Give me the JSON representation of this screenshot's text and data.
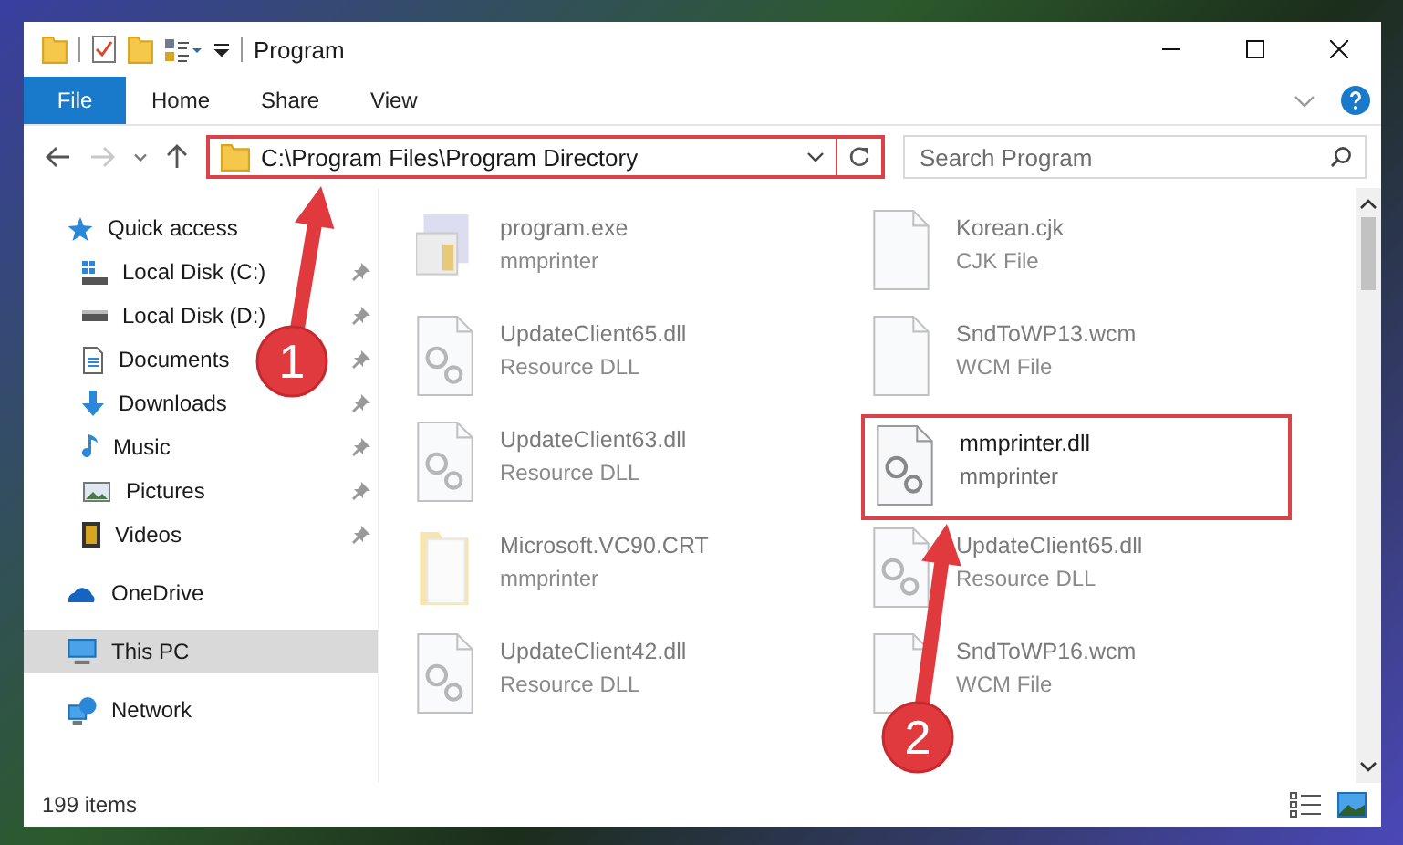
{
  "window": {
    "title": "Program"
  },
  "ribbon": {
    "tabs": [
      {
        "label": "File",
        "selected": true
      },
      {
        "label": "Home",
        "selected": false
      },
      {
        "label": "Share",
        "selected": false
      },
      {
        "label": "View",
        "selected": false
      }
    ]
  },
  "address_bar": {
    "path": "C:\\Program Files\\Program Directory",
    "highlighted": true
  },
  "search": {
    "placeholder": "Search Program"
  },
  "sidebar": {
    "items": [
      {
        "label": "Quick access",
        "selected": false,
        "children": [
          {
            "label": "Local Disk (C:)",
            "pinned": true,
            "selected": false
          },
          {
            "label": "Local Disk (D:)",
            "pinned": true,
            "selected": false
          },
          {
            "label": "Documents",
            "pinned": true,
            "selected": false
          },
          {
            "label": "Downloads",
            "pinned": true,
            "selected": false
          },
          {
            "label": "Music",
            "pinned": true,
            "selected": false
          },
          {
            "label": "Pictures",
            "pinned": true,
            "selected": false
          },
          {
            "label": "Videos",
            "pinned": true,
            "selected": false
          }
        ]
      },
      {
        "label": "OneDrive",
        "selected": false
      },
      {
        "label": "This PC",
        "selected": true
      },
      {
        "label": "Network",
        "selected": false
      }
    ]
  },
  "files": [
    {
      "name": "program.exe",
      "type": "mmprinter",
      "kind": "exe",
      "highlighted": false
    },
    {
      "name": "Korean.cjk",
      "type": "CJK File",
      "kind": "blank",
      "highlighted": false
    },
    {
      "name": "UpdateClient65.dll",
      "type": "Resource DLL",
      "kind": "dll",
      "highlighted": false
    },
    {
      "name": "SndToWP13.wcm",
      "type": "WCM File",
      "kind": "blank",
      "highlighted": false
    },
    {
      "name": "UpdateClient63.dll",
      "type": "Resource DLL",
      "kind": "dll",
      "highlighted": false
    },
    {
      "name": "mmprinter.dll",
      "type": "mmprinter",
      "kind": "dll",
      "highlighted": true
    },
    {
      "name": "Microsoft.VC90.CRT",
      "type": "mmprinter",
      "kind": "folder",
      "highlighted": false
    },
    {
      "name": "UpdateClient65.dll",
      "type": "Resource DLL",
      "kind": "dll",
      "highlighted": false
    },
    {
      "name": "UpdateClient42.dll",
      "type": "Resource DLL",
      "kind": "dll",
      "highlighted": false
    },
    {
      "name": "SndToWP16.wcm",
      "type": "WCM File",
      "kind": "blank",
      "highlighted": false
    }
  ],
  "status_bar": {
    "item_count": "199 items"
  },
  "annotations": [
    {
      "number": "1"
    },
    {
      "number": "2"
    }
  ]
}
